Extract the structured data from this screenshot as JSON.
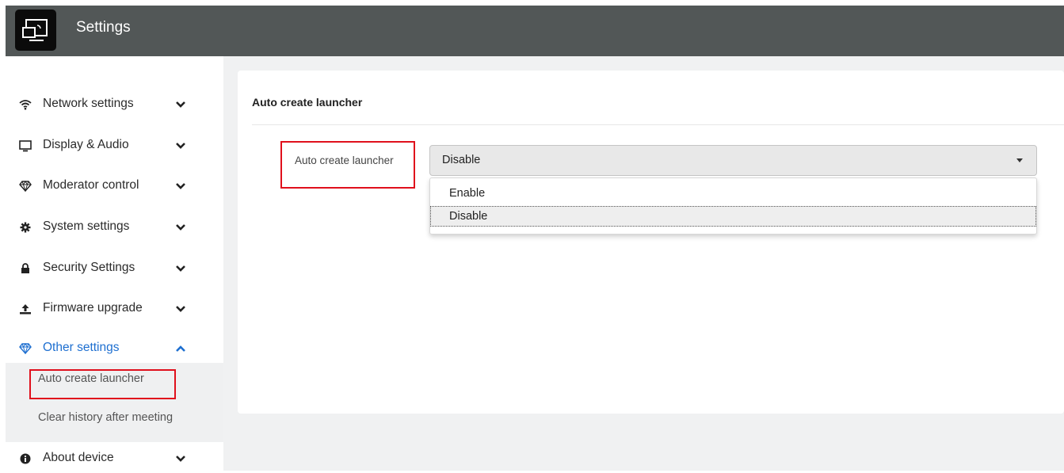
{
  "app": {
    "title": "Settings"
  },
  "sidebar": {
    "items": [
      {
        "label": "Network settings",
        "icon": "wifi-icon",
        "expanded": false
      },
      {
        "label": "Display & Audio",
        "icon": "monitor-icon",
        "expanded": false
      },
      {
        "label": "Moderator control",
        "icon": "diamond-icon",
        "expanded": false
      },
      {
        "label": "System settings",
        "icon": "gear-icon",
        "expanded": false
      },
      {
        "label": "Security Settings",
        "icon": "lock-icon",
        "expanded": false
      },
      {
        "label": "Firmware upgrade",
        "icon": "upload-icon",
        "expanded": false
      },
      {
        "label": "Other settings",
        "icon": "diamond-icon",
        "expanded": true
      },
      {
        "label": "About device",
        "icon": "info-icon",
        "expanded": false
      }
    ],
    "sub_items": [
      {
        "label": "Auto create launcher",
        "selected": true
      },
      {
        "label": "Clear history after meeting",
        "selected": false
      }
    ]
  },
  "panel": {
    "title": "Auto create launcher",
    "field_label": "Auto create launcher",
    "select": {
      "value": "Disable",
      "options": [
        "Enable",
        "Disable"
      ],
      "selected_index": 1
    }
  },
  "colors": {
    "topbar": "#525757",
    "accent": "#1e6fd0",
    "highlight": "#e0101c",
    "background": "#f0f1f2"
  }
}
